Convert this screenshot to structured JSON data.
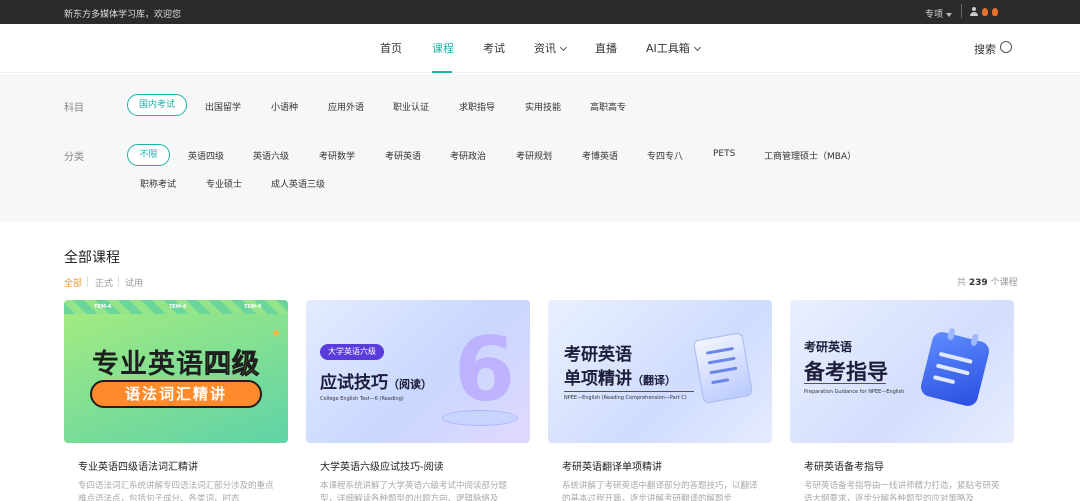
{
  "topbar": {
    "welcome": "新东方多媒体学习库，欢迎您",
    "special": "专项"
  },
  "nav": {
    "items": [
      "首页",
      "课程",
      "考试",
      "资讯",
      "直播",
      "AI工具箱"
    ],
    "search": "搜索"
  },
  "filters": {
    "subject": {
      "label": "科目",
      "options": [
        "国内考试",
        "出国留学",
        "小语种",
        "应用外语",
        "职业认证",
        "求职指导",
        "实用技能",
        "高职高专"
      ],
      "selected": "国内考试"
    },
    "category": {
      "label": "分类",
      "options": [
        "不限",
        "英语四级",
        "英语六级",
        "考研数学",
        "考研英语",
        "考研政治",
        "考研规划",
        "考博英语",
        "专四专八",
        "PETS",
        "工商管理硕士（MBA）",
        "职称考试",
        "专业硕士",
        "成人英语三级"
      ],
      "selected": "不限"
    }
  },
  "courses": {
    "title": "全部课程",
    "tabs": [
      "全部",
      "正式",
      "试用"
    ],
    "active_tab": "全部",
    "count_prefix": "共",
    "count": "239",
    "count_suffix": "个课程",
    "items": [
      {
        "title": "专业英语四级语法词汇精讲",
        "desc": "专四语法词汇系统讲解专四语法词汇部分涉及的重点难点语法点，包括句子成分、各类词、时态",
        "cover": {
          "tem": "TEM-4",
          "line1_a": "专业英语",
          "line1_b": "四级",
          "banner": "语法词汇精讲"
        }
      },
      {
        "title": "大学英语六级应试技巧-阅读",
        "desc": "本课程系统讲解了大学英语六级考试中阅读部分题型，详细解读各种题型的出题方向、逻辑脉络及",
        "cover": {
          "tag": "大学英语六级",
          "title": "应试技巧",
          "title_sub": "（阅读）",
          "subtitle": "College English Test—6 (Reading)",
          "numeral": "6"
        }
      },
      {
        "title": "考研英语翻译单项精讲",
        "desc": "系统讲解了考研英语中翻译部分的答题技巧，以翻译的基本过程开篇，逐步讲解考研翻译的解题步",
        "cover": {
          "line1": "考研英语",
          "line2": "单项精讲",
          "line2_sub": "（翻译）",
          "subtitle": "NPEE—English (Reading Comprehension—Part C)"
        }
      },
      {
        "title": "考研英语备考指导",
        "desc": "考研英语备考指导由一线讲师精力打造，紧贴考研英语大纲要求，逐步分解各种题型的应对策略及",
        "cover": {
          "line1": "考研英语",
          "line2": "备考指导",
          "subtitle": "Preparation Guidance for NPEE—English"
        }
      }
    ]
  },
  "colors": {
    "accent": "#20b2aa",
    "tab_active": "#e89b2d",
    "topbar": "#2b2b2b"
  }
}
